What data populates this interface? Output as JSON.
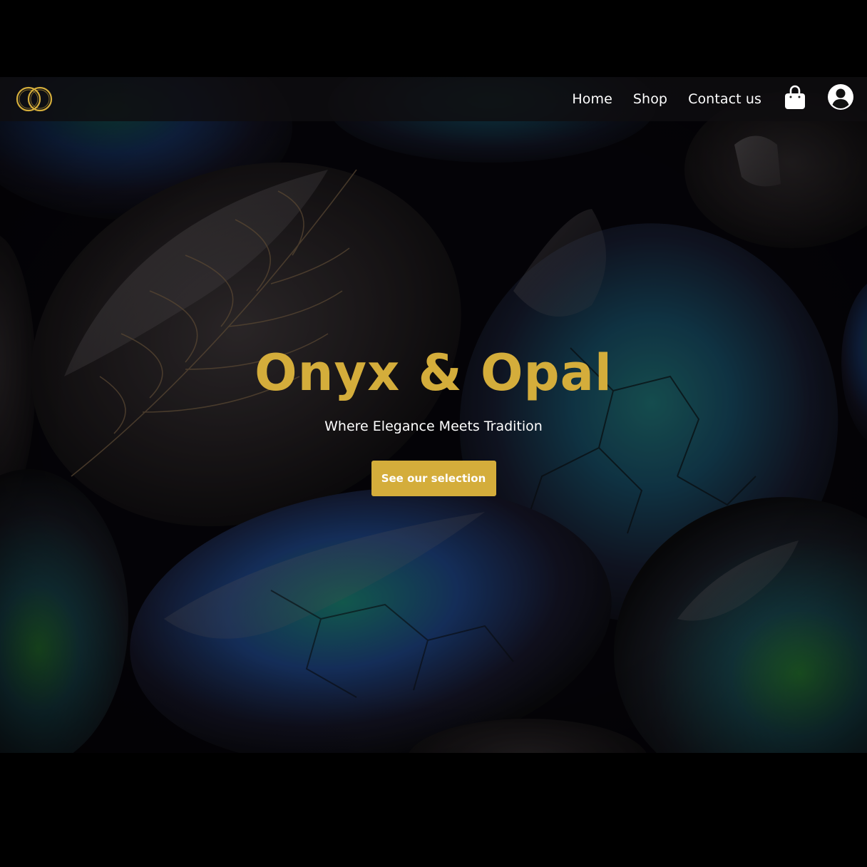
{
  "brand": {
    "logo_icon": "interlocking-rings-icon",
    "accent_color": "#d4ad3b"
  },
  "nav": {
    "links": [
      {
        "label": "Home"
      },
      {
        "label": "Shop"
      },
      {
        "label": "Contact us"
      }
    ],
    "cart_icon": "shopping-bag-icon",
    "user_icon": "user-circle-icon"
  },
  "hero": {
    "title": "Onyx & Opal",
    "subtitle": "Where Elegance Meets Tradition",
    "cta_label": "See our selection",
    "background": "dark labradorite gemstones"
  }
}
